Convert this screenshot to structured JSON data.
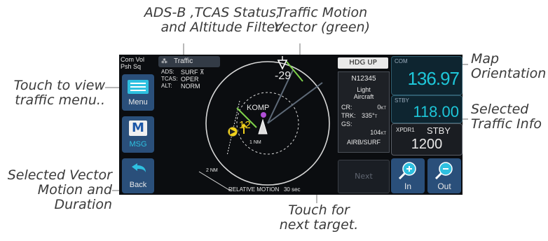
{
  "callouts": {
    "ads_b": "ADS-B ,TCAS Status,\nand Altitude Filter",
    "motion_vector": "Traffic Motion\nVector (green)",
    "touch_menu": "Touch to view\ntraffic menu..",
    "map_orientation": "Map\nOrientation",
    "selected_info": "Selected\nTraffic Info",
    "selected_vector": "Selected Vector\nMotion and\nDuration",
    "next_target": "Touch for\nnext target."
  },
  "left_panel": {
    "com_vol": "Com Vol",
    "psh_sq": "Psh Sq",
    "menu": "Menu",
    "msg_icon": "M",
    "msg": "MSG",
    "back": "Back"
  },
  "header": {
    "traffic_title": "Traffic",
    "hdg_up": "HDG UP"
  },
  "status": {
    "ads_label": "ADS:",
    "ads_value": "SURF",
    "tcas_label": "TCAS:",
    "tcas_value": "OPER",
    "alt_label": "ALT:",
    "alt_value": "NORM"
  },
  "radar": {
    "traffic_rel_alt": "-29",
    "selected_rel_alt": "12",
    "airport_id": "KOMP",
    "range_outer": "2 NM",
    "range_inner": "1 NM",
    "motion_mode": "RELATIVE MOTION",
    "motion_duration": "30 sec"
  },
  "target_info": {
    "tail": "N12345",
    "category_line1": "Light",
    "category_line2": "Aircraft",
    "cr_label": "CR:",
    "cr_value": "0",
    "cr_unit": "KT",
    "trk_label": "TRK:",
    "trk_value": "335°",
    "trk_unit": "T",
    "gs_label": "GS:",
    "gs_value": "104",
    "gs_unit": "KT",
    "state": "AIRB/SURF"
  },
  "next_button": "Next",
  "radio": {
    "com_label": "COM",
    "com_active": "136.97",
    "stby_label": "STBY",
    "com_standby": "118.00",
    "xpdr_label": "XPDR1",
    "xpdr_mode": "STBY",
    "xpdr_code": "1200"
  },
  "zoom": {
    "in": "In",
    "out": "Out"
  },
  "colors": {
    "accent_cyan": "#1ec6d8",
    "vector_green": "#7fd24a",
    "traffic_yellow": "#f2d21c",
    "ownship_purple": "#b04fd6"
  }
}
